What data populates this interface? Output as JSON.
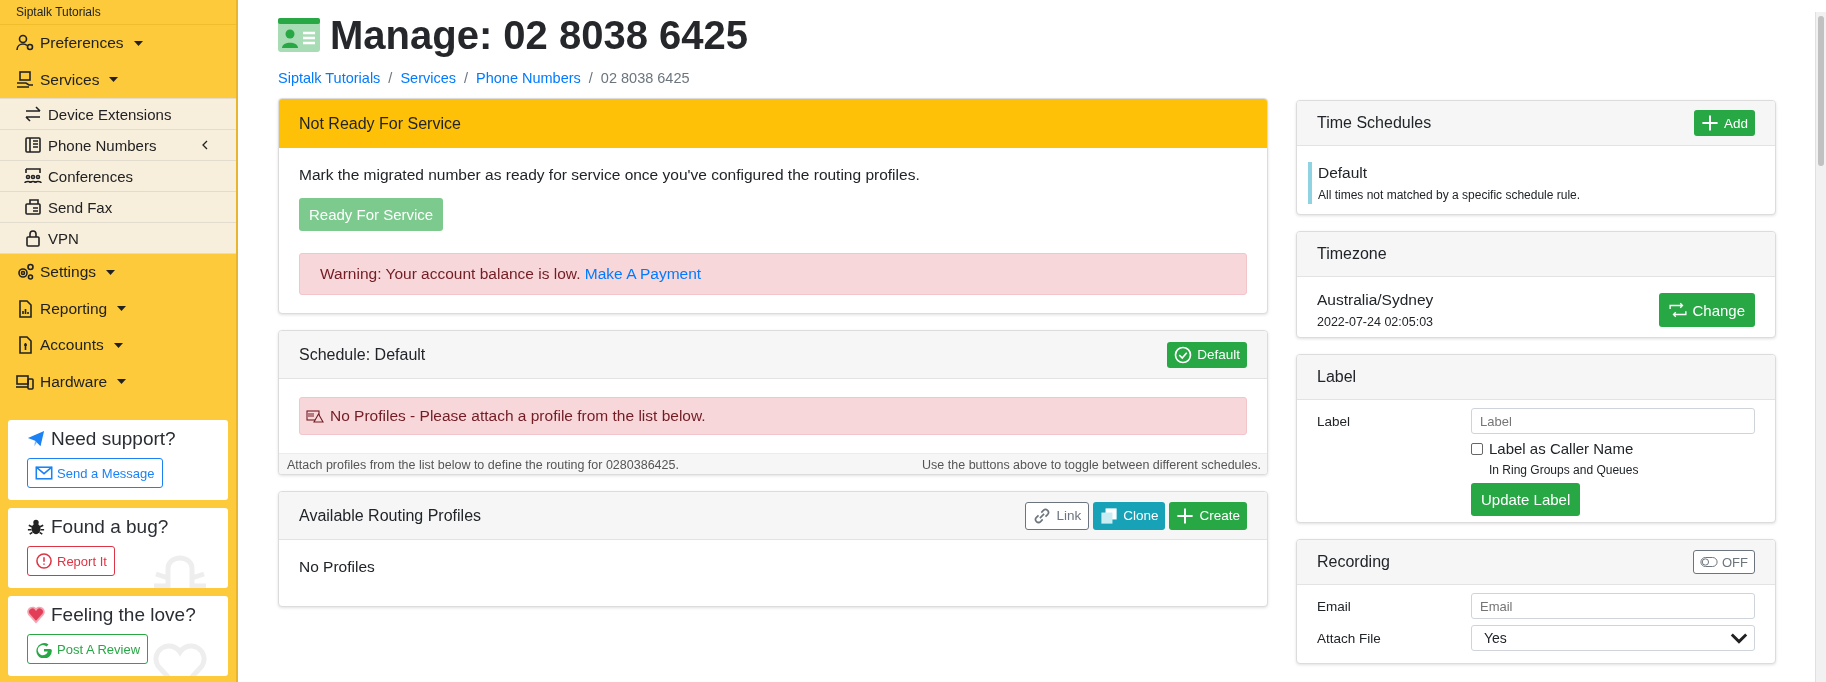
{
  "sidebar": {
    "org": "Siptalk Tutorials",
    "items": [
      {
        "label": "Preferences"
      },
      {
        "label": "Services",
        "expanded": true,
        "children": [
          {
            "label": "Device Extensions",
            "submenu": false
          },
          {
            "label": "Phone Numbers",
            "submenu": true
          },
          {
            "label": "Conferences",
            "submenu": false
          },
          {
            "label": "Send Fax",
            "submenu": false
          },
          {
            "label": "VPN",
            "submenu": false
          }
        ]
      },
      {
        "label": "Settings"
      },
      {
        "label": "Reporting"
      },
      {
        "label": "Accounts"
      },
      {
        "label": "Hardware"
      }
    ],
    "cards": [
      {
        "kind": "support",
        "title": "Need support?",
        "button": "Send a Message"
      },
      {
        "kind": "bug",
        "title": "Found a bug?",
        "button": "Report It"
      },
      {
        "kind": "love",
        "title": "Feeling the love?",
        "button": "Post A Review"
      }
    ]
  },
  "page": {
    "title": "Manage: 02 8038 6425",
    "breadcrumb": [
      {
        "label": "Siptalk Tutorials",
        "current": false
      },
      {
        "separator": "/",
        "label": "Services",
        "current": false
      },
      {
        "separator": "/",
        "label": "Phone Numbers",
        "current": false
      },
      {
        "separator": "/",
        "label": "02 8038 6425",
        "current": true
      }
    ]
  },
  "status_card": {
    "header": "Not Ready For Service",
    "text": "Mark the migrated number as ready for service once you've configured the routing profiles.",
    "button": {
      "label": "Ready For Service",
      "disabled": true
    },
    "alert": {
      "text": "Warning: Your account balance is low.",
      "link": "Make A Payment"
    }
  },
  "schedule_card": {
    "header": "Schedule: Default",
    "badge": "Default",
    "alert": "No Profiles - Please attach a profile from the list below.",
    "footer_left": "Attach profiles from the list below to define the routing for 0280386425.",
    "footer_right": "Use the buttons above to toggle between different schedules."
  },
  "profiles_card": {
    "header": "Available Routing Profiles",
    "buttons": [
      {
        "kind": "link",
        "label": "Link"
      },
      {
        "kind": "clone",
        "label": "Clone"
      },
      {
        "kind": "create",
        "label": "Create"
      }
    ],
    "empty": "No Profiles"
  },
  "time_schedules": {
    "title": "Time Schedules",
    "add_button": "Add",
    "items": [
      {
        "name": "Default",
        "description": "All times not matched by a specific schedule rule."
      }
    ]
  },
  "timezone": {
    "title": "Timezone",
    "name": "Australia/Sydney",
    "time": "2022-07-24 02:05:03",
    "button": "Change"
  },
  "label_card": {
    "title": "Label",
    "field_label": "Label",
    "placeholder": "Label",
    "checkbox": {
      "label": "Label as Caller Name",
      "checked": false,
      "hint": "In Ring Groups and Queues"
    },
    "button": "Update Label"
  },
  "recording": {
    "title": "Recording",
    "toggle": {
      "label": "OFF",
      "on": false
    },
    "fields": [
      {
        "kind": "input",
        "label": "Email",
        "placeholder": "Email"
      },
      {
        "kind": "select",
        "label": "Attach File",
        "value": "Yes"
      }
    ]
  }
}
